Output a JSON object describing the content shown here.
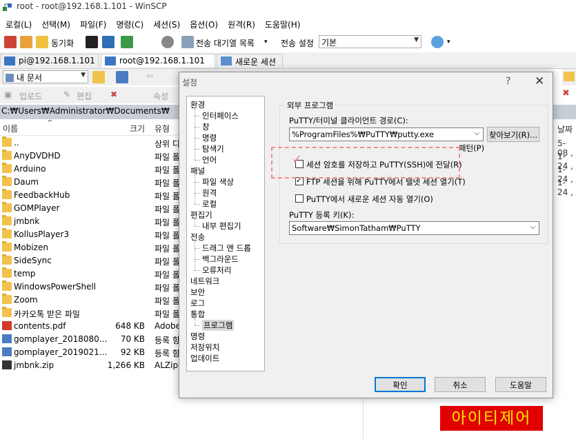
{
  "window": {
    "title": "root - root@192.168.1.101 - WinSCP"
  },
  "menu": [
    "로컬(L)",
    "선택(M)",
    "파일(F)",
    "명령(C)",
    "세션(S)",
    "옵션(O)",
    "원격(R)",
    "도움말(H)"
  ],
  "toolbar": {
    "sync_label": "동기화",
    "queue_label": "전송 대기열 목록",
    "transfer_settings_label": "전송 설정",
    "transfer_preset": "기본"
  },
  "tabs": [
    "pi@192.168.1.101",
    "root@192.168.1.101",
    "새로운 세션"
  ],
  "left_panel": {
    "location": "내 문서",
    "actions": {
      "upload": "업로드",
      "edit": "편집",
      "properties": "속성"
    },
    "path": "C:₩Users₩Administrator₩Documents₩",
    "columns": {
      "name": "이름",
      "size": "크기",
      "type": "유형"
    },
    "rows": [
      {
        "name": "..",
        "size": "",
        "type": "상위 디",
        "kind": "up"
      },
      {
        "name": "AnyDVDHD",
        "size": "",
        "type": "파일 폴",
        "kind": "folder"
      },
      {
        "name": "Arduino",
        "size": "",
        "type": "파일 폴",
        "kind": "folder"
      },
      {
        "name": "Daum",
        "size": "",
        "type": "파일 폴",
        "kind": "folder"
      },
      {
        "name": "FeedbackHub",
        "size": "",
        "type": "파일 폴",
        "kind": "folder"
      },
      {
        "name": "GOMPlayer",
        "size": "",
        "type": "파일 폴",
        "kind": "folder"
      },
      {
        "name": "jmbnk",
        "size": "",
        "type": "파일 폴",
        "kind": "folder"
      },
      {
        "name": "KollusPlayer3",
        "size": "",
        "type": "파일 폴",
        "kind": "folder"
      },
      {
        "name": "Mobizen",
        "size": "",
        "type": "파일 폴",
        "kind": "folder"
      },
      {
        "name": "SideSync",
        "size": "",
        "type": "파일 폴",
        "kind": "folder"
      },
      {
        "name": "temp",
        "size": "",
        "type": "파일 폴",
        "kind": "folder"
      },
      {
        "name": "WindowsPowerShell",
        "size": "",
        "type": "파일 폴",
        "kind": "folder"
      },
      {
        "name": "Zoom",
        "size": "",
        "type": "파일 폴",
        "kind": "folder"
      },
      {
        "name": "카카오톡 받은 파일",
        "size": "",
        "type": "파일 폴",
        "kind": "folder"
      },
      {
        "name": "contents.pdf",
        "size": "648 KB",
        "type": "Adobe",
        "kind": "pdf"
      },
      {
        "name": "gomplayer_2018080...",
        "size": "70 KB",
        "type": "등록 항",
        "kind": "reg"
      },
      {
        "name": "gomplayer_2019021...",
        "size": "92 KB",
        "type": "등록 항",
        "kind": "reg"
      },
      {
        "name": "jmbnk.zip",
        "size": "1,266 KB",
        "type": "ALZip",
        "kind": "zip"
      }
    ]
  },
  "right_panel": {
    "col_header": "날짜",
    "dates": [
      "5-08 ,",
      "1-24 ,",
      "1-24 ,",
      "1-24 ,"
    ]
  },
  "dialog": {
    "title": "설정",
    "help": "?",
    "close": "✕",
    "tree": [
      {
        "label": "환경",
        "level": 0
      },
      {
        "label": "인터페이스",
        "level": 1
      },
      {
        "label": "창",
        "level": 1
      },
      {
        "label": "명령",
        "level": 1
      },
      {
        "label": "탐색기",
        "level": 1
      },
      {
        "label": "언어",
        "level": 1
      },
      {
        "label": "패널",
        "level": 0
      },
      {
        "label": "파일 색상",
        "level": 1
      },
      {
        "label": "원격",
        "level": 1
      },
      {
        "label": "로컬",
        "level": 1
      },
      {
        "label": "편집기",
        "level": 0
      },
      {
        "label": "내부 편집기",
        "level": 1
      },
      {
        "label": "전송",
        "level": 0
      },
      {
        "label": "드래그 앤 드롭",
        "level": 1
      },
      {
        "label": "백그라운드",
        "level": 1
      },
      {
        "label": "오류처리",
        "level": 1
      },
      {
        "label": "네트워크",
        "level": 0
      },
      {
        "label": "보안",
        "level": 0
      },
      {
        "label": "로그",
        "level": 0
      },
      {
        "label": "통합",
        "level": 0
      },
      {
        "label": "프로그램",
        "level": 1,
        "selected": true
      },
      {
        "label": "명령",
        "level": 0
      },
      {
        "label": "저장위치",
        "level": 0
      },
      {
        "label": "업데이트",
        "level": 0
      }
    ],
    "group_title": "외부 프로그램",
    "putty_path_label": "PuTTY/터미널 클라이언트 경로(C):",
    "putty_path_value": "%ProgramFiles%₩PuTTY₩putty.exe",
    "browse_label": "찾아보기(R)...",
    "pattern_label": "패턴(P)",
    "checkboxes": [
      {
        "label": "세션 암호를 저장하고 PuTTY(SSH)에 전달(R)",
        "checked": false
      },
      {
        "label": "FTP 세션을 위해 PuTTY에서 텔넷 세션 열기(T)",
        "checked": true
      },
      {
        "label": "PuTTY에서 새로운 세션 자동 열기(O)",
        "checked": false
      }
    ],
    "registry_label": "PuTTY 등록 키(K):",
    "registry_value": "Software₩SimonTatham₩PuTTY",
    "buttons": {
      "ok": "확인",
      "cancel": "취소",
      "help": "도움말"
    }
  },
  "watermark": "아이티제어"
}
